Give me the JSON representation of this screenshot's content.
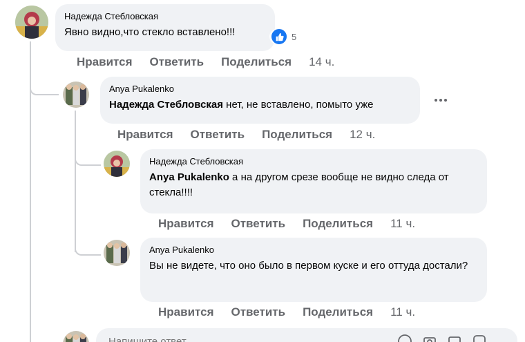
{
  "comments": [
    {
      "author": "Надежда Стебловская",
      "text": "Явно видно,что стекло вставлено!!!",
      "reactions": {
        "icon": "like-icon",
        "count": "5"
      },
      "actions": {
        "like": "Нравится",
        "reply": "Ответить",
        "share": "Поделиться"
      },
      "time": "14 ч."
    },
    {
      "author": "Anya Pukalenko",
      "mention": "Надежда Стебловская",
      "text": " нет, не вставлено, помыто уже",
      "actions": {
        "like": "Нравится",
        "reply": "Ответить",
        "share": "Поделиться"
      },
      "time": "12 ч."
    },
    {
      "author": "Надежда Стебловская",
      "mention": "Anya Pukalenko",
      "text": " а на другом срезе вообще не видно следа от стекла!!!!",
      "actions": {
        "like": "Нравится",
        "reply": "Ответить",
        "share": "Поделиться"
      },
      "time": "11 ч."
    },
    {
      "author": "Anya Pukalenko",
      "text": "Вы не видете, что оно было в первом куске и его оттуда достали?",
      "actions": {
        "like": "Нравится",
        "reply": "Ответить",
        "share": "Поделиться"
      },
      "time": "11 ч."
    }
  ],
  "reply_input": {
    "placeholder": "Напишите ответ..."
  },
  "colors": {
    "bubble": "#f0f2f5",
    "action_text": "#65676b",
    "like_blue": "#1877f2",
    "thread_line": "#ced0d4"
  }
}
